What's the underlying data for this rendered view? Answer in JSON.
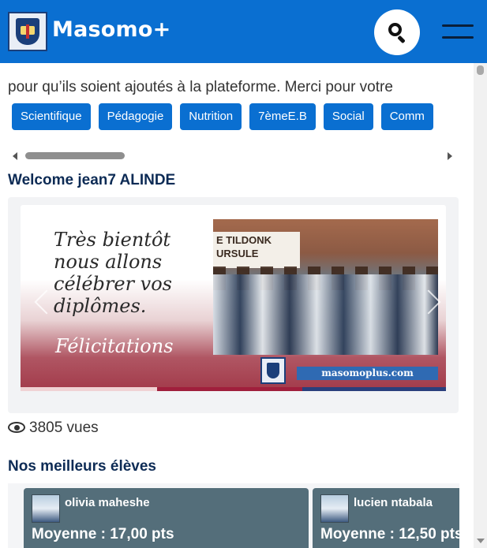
{
  "header": {
    "brand": "Masomo+",
    "colors": {
      "primary": "#0a6fd1",
      "dark": "#0d2b55"
    }
  },
  "notice": {
    "text": "pour qu’ils soient ajoutés à la plateforme. Merci pour votre"
  },
  "tags": [
    "Scientifique",
    "Pédagogie",
    "Nutrition",
    "7èmeE.B",
    "Social",
    "Comm"
  ],
  "welcome": {
    "text": "Welcome jean7 ALINDE"
  },
  "carousel": {
    "lines": [
      "Très bientôt",
      "nous allons",
      "célébrer vos",
      "diplômes."
    ],
    "congrats": "Félicitations",
    "sign": [
      "E TILDONK",
      "URSULE"
    ],
    "url": "masomoplus.com"
  },
  "views": {
    "count": "3805 vues"
  },
  "best": {
    "title": "Nos meilleurs élèves",
    "students": [
      {
        "name": "olivia maheshe",
        "average": "Moyenne : 17,00 pts"
      },
      {
        "name": "lucien ntabala",
        "average": "Moyenne : 12,50 pts"
      }
    ]
  }
}
